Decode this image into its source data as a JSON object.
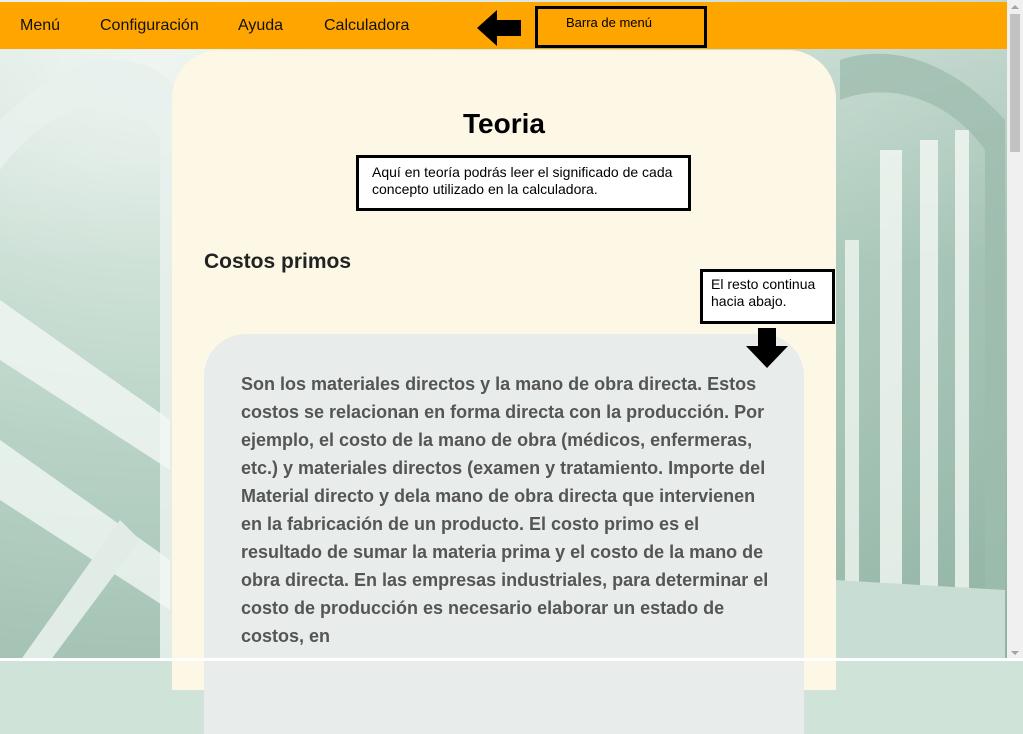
{
  "menu": {
    "items": [
      "Menú",
      "Configuración",
      "Ayuda",
      "Calculadora"
    ]
  },
  "annotations": {
    "menubar_label": "Barra de menú",
    "theory_note": "Aquí en teoría podrás leer el significado de cada concepto utilizado en la calculadora.",
    "scroll_note": "El resto continua hacia abajo."
  },
  "page": {
    "title": "Teoria",
    "section_heading": "Costos primos",
    "section_text": "Son los materiales directos y la mano de obra directa. Estos costos se relacionan en forma directa con la producción. Por ejemplo, el costo de la mano de obra (médicos, enfermeras, etc.) y materiales directos (examen y tratamiento. Importe del Material directo y dela mano de obra directa que intervienen en la fabricación de un producto. El costo primo es el resultado de sumar la materia prima y el costo de la mano de obra directa. En las empresas industriales, para determinar el costo de producción es necesario elaborar un estado de costos, en"
  },
  "colors": {
    "menubar": "#ffa500",
    "card": "#fdf7e6",
    "inner_card": "#e8ecea"
  }
}
